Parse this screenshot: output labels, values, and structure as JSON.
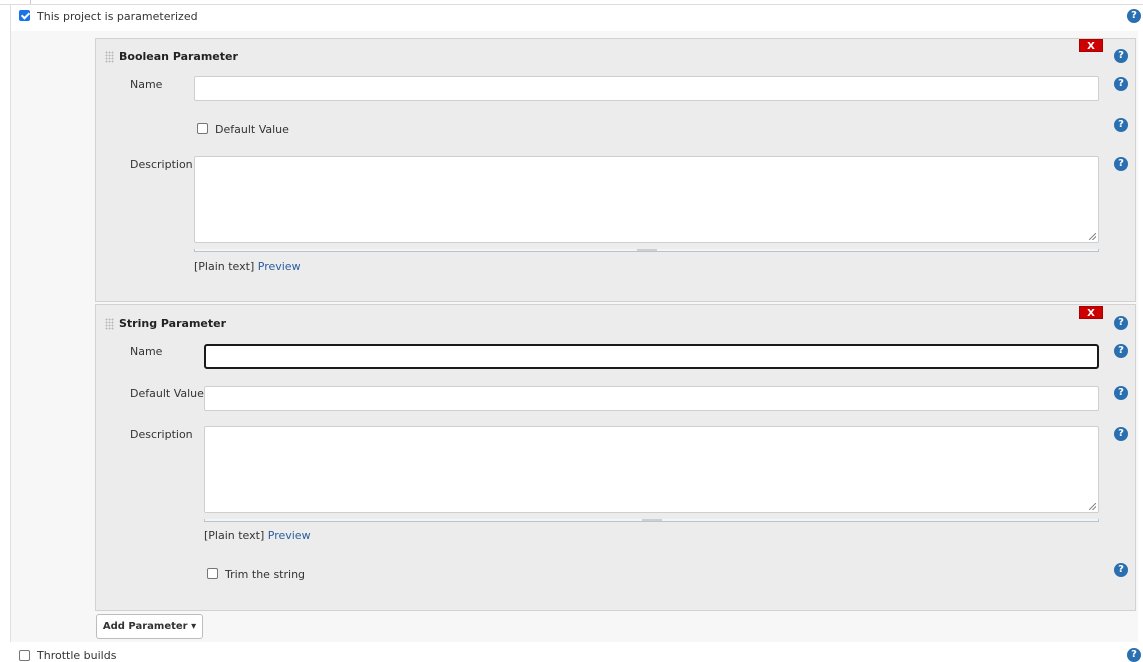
{
  "parameterized": {
    "label": "This project is parameterized",
    "checked": true
  },
  "boolean_param": {
    "title": "Boolean Parameter",
    "delete_label": "X",
    "name_label": "Name",
    "name_value": "",
    "default_label": "Default Value",
    "default_checked": false,
    "description_label": "Description",
    "description_value": "",
    "format_prefix": "[Plain text]",
    "preview_label": "Preview"
  },
  "string_param": {
    "title": "String Parameter",
    "delete_label": "X",
    "name_label": "Name",
    "name_value": "",
    "default_label": "Default Value",
    "default_value": "",
    "description_label": "Description",
    "description_value": "",
    "format_prefix": "[Plain text]",
    "preview_label": "Preview",
    "trim_label": "Trim the string",
    "trim_checked": false
  },
  "add_parameter": {
    "label": "Add Parameter ▾"
  },
  "throttle": {
    "label": "Throttle builds",
    "checked": false
  },
  "icons": {
    "help": "help-icon",
    "grip": "drag-handle-icon"
  },
  "colors": {
    "accent": "#1a73e8",
    "help": "#2a6fb0",
    "delete": "#cc0000",
    "link": "#2a5d9f"
  }
}
